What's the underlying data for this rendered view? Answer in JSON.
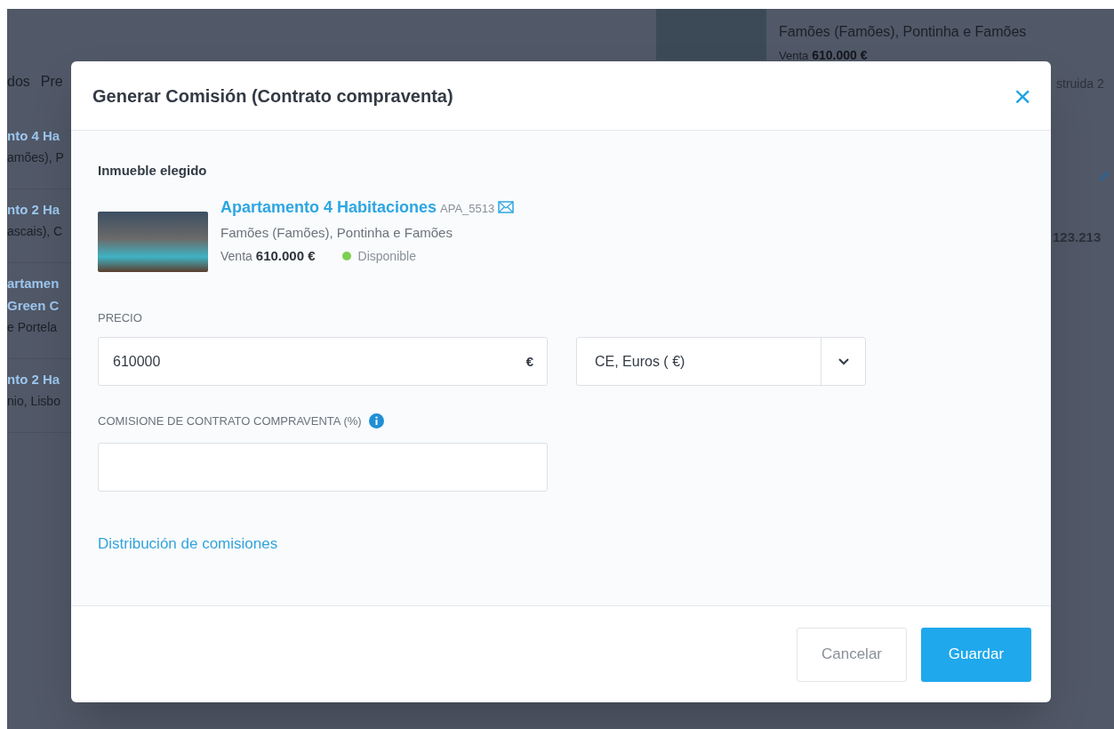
{
  "background": {
    "tabs": [
      "dos",
      "Pre"
    ],
    "list_items": [
      {
        "title_lines": [
          "nto 4 Ha"
        ],
        "subtitle": "amões), P"
      },
      {
        "title_lines": [
          "nto 2 Ha"
        ],
        "subtitle": "ascais), C"
      },
      {
        "title_lines": [
          "artamen",
          "Green C"
        ],
        "subtitle": "e Portela"
      },
      {
        "title_lines": [
          "nto 2 Ha"
        ],
        "subtitle": "nio, Lisbo"
      }
    ],
    "card": {
      "location": "Famões (Famões), Pontinha e Famões",
      "sale_label": "Venta",
      "sale_price": "610.000 €"
    },
    "side_texts": [
      "struida 2",
      "123.213"
    ]
  },
  "modal": {
    "title": "Generar Comisión (Contrato compraventa)",
    "close": "×",
    "section_title": "Inmueble elegido",
    "property": {
      "title": "Apartamento 4 Habitaciones",
      "reference": "APA_5513",
      "location": "Famões (Famões), Pontinha e Famões",
      "sale_label": "Venta",
      "price": "610.000 €",
      "status": {
        "label": "Disponible",
        "color": "#7dd04f"
      }
    },
    "price": {
      "label": "PRECIO",
      "value": "610000",
      "suffix": "€",
      "currency": "CE, Euros ( €)"
    },
    "commission": {
      "label": "COMISIONE DE CONTRATO COMPRAVENTA (%)"
    },
    "link": "Distribución de comisiones",
    "buttons": [
      {
        "label": "Cancelar",
        "kind": "secondary"
      },
      {
        "label": "Guardar",
        "kind": "primary"
      }
    ]
  }
}
